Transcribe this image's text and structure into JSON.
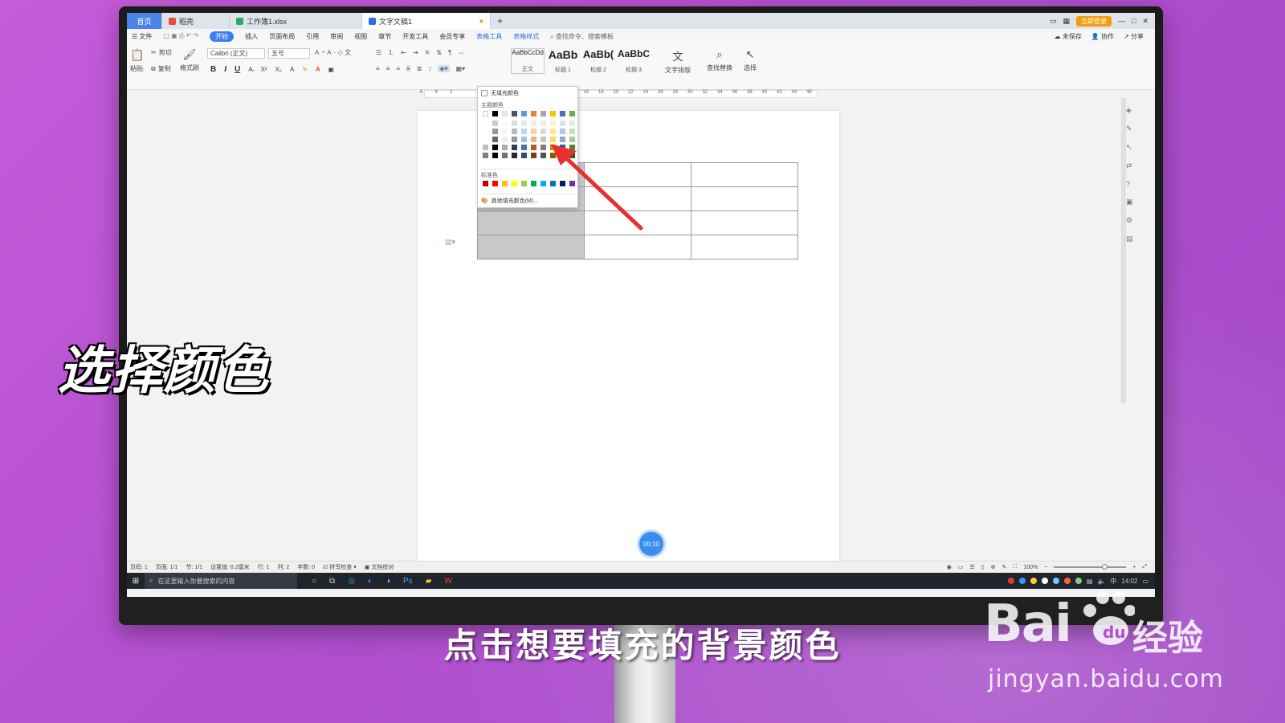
{
  "tabs": [
    {
      "label": "首页"
    },
    {
      "label": "稻壳"
    },
    {
      "label": "工作簿1.xlsx"
    },
    {
      "label": "文字文稿1"
    }
  ],
  "title_right": {
    "vip": "立即登录"
  },
  "menu": {
    "file": "文件",
    "items": [
      "开始",
      "插入",
      "页面布局",
      "引用",
      "审阅",
      "视图",
      "章节",
      "开发工具",
      "会员专享"
    ],
    "contextual": [
      "表格工具",
      "表格样式"
    ],
    "search": "查找命令、搜索模板",
    "right": [
      "未保存",
      "协作",
      "分享"
    ]
  },
  "ribbon": {
    "cut": "剪切",
    "copy": "复制",
    "paste": "粘贴",
    "format_painter": "格式刷",
    "font_name": "Calibri (正文)",
    "font_size": "五号",
    "bold": "B",
    "italic": "I",
    "underline": "U",
    "styles": [
      {
        "preview": "AaBbCcDd",
        "name": "正文"
      },
      {
        "preview": "AaBb",
        "name": "标题 1"
      },
      {
        "preview": "AaBb(",
        "name": "标题 2"
      },
      {
        "preview": "AaBbC",
        "name": "标题 3"
      }
    ],
    "text_layout": "文字排版",
    "find_replace": "查找替换",
    "select": "选择"
  },
  "ruler": [
    "6",
    "4",
    "2",
    "",
    "2",
    "4",
    "6",
    "8",
    "10",
    "12",
    "14",
    "16",
    "18",
    "20",
    "22",
    "24",
    "26",
    "28",
    "30",
    "32",
    "34",
    "36",
    "38",
    "40",
    "42",
    "44",
    "46"
  ],
  "fill_dropdown": {
    "no_fill": "无填充颜色",
    "theme_colors_label": "主题颜色",
    "standard_colors_label": "标准色",
    "more_colors": "其他填充颜色(M)...",
    "theme_top": [
      "#ffffff",
      "#000000",
      "#e7e6e6",
      "#44546a",
      "#5b9bd5",
      "#ed7d31",
      "#a5a5a5",
      "#ffc000",
      "#4472c4",
      "#70ad47"
    ],
    "standard": [
      "#c00000",
      "#ff0000",
      "#ffc000",
      "#ffff00",
      "#92d050",
      "#00b050",
      "#00b0f0",
      "#0070c0",
      "#002060",
      "#7030a0"
    ]
  },
  "status": {
    "items": [
      "页码: 1",
      "页面: 1/1",
      "节: 1/1",
      "设置值: 6.2厘米",
      "行: 1",
      "列: 2",
      "字数: 0",
      "拼写检查",
      "文档校对"
    ],
    "zoom": "100%"
  },
  "taskbar": {
    "search_placeholder": "在这里输入你要搜索的内容",
    "time": "14:02",
    "ime": "中"
  },
  "timer": "00:10",
  "overlay_title": "选择颜色",
  "subtitle": "点击想要填充的背景颜色",
  "watermark": {
    "logo": "Bai",
    "cn": "经验",
    "url": "jingyan.baidu.com"
  }
}
